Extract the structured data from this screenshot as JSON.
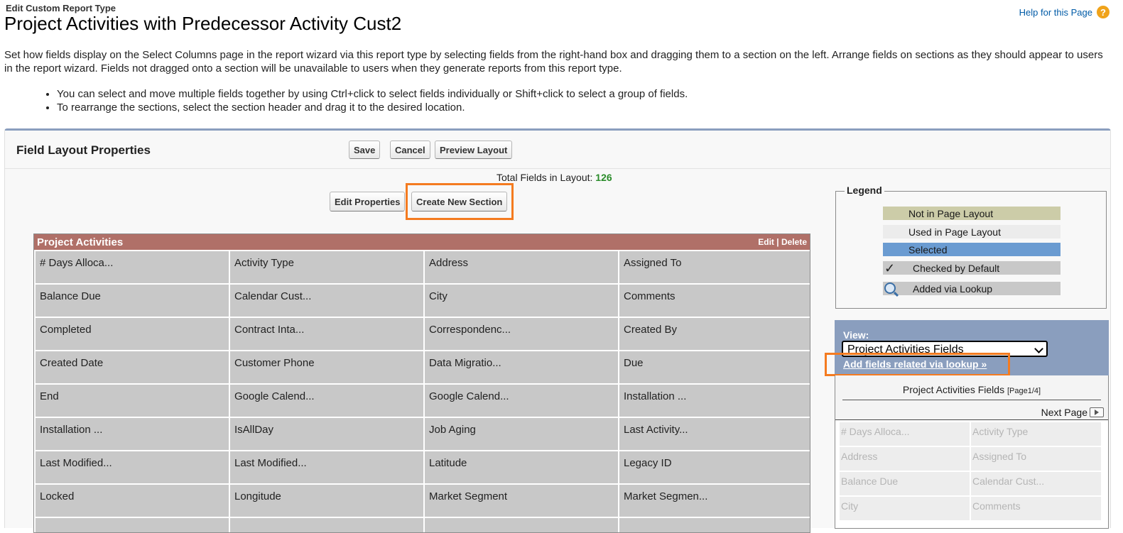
{
  "header": {
    "subtitle": "Edit Custom Report Type",
    "title": "Project Activities with Predecessor Activity Cust2",
    "help_link": "Help for this Page"
  },
  "description": "Set how fields display on the Select Columns page in the report wizard via this report type by selecting fields from the right-hand box and dragging them to a section on the left. Arrange fields on sections as they should appear to users in the report wizard. Fields not dragged onto a section will be unavailable to users when they generate reports from this report type.",
  "tips": [
    "You can select and move multiple fields together by using Ctrl+click to select fields individually or Shift+click to select a group of fields.",
    "To rearrange the sections, select the section header and drag it to the desired location."
  ],
  "layout": {
    "title": "Field Layout Properties",
    "save_label": "Save",
    "cancel_label": "Cancel",
    "preview_label": "Preview Layout",
    "total_label": "Total Fields in Layout:",
    "total_count": "126",
    "edit_properties_label": "Edit Properties",
    "create_section_label": "Create New Section"
  },
  "section": {
    "title": "Project Activities",
    "edit_label": "Edit",
    "separator": " | ",
    "delete_label": "Delete",
    "fields": [
      "# Days Alloca...",
      "Activity Type",
      "Address",
      "Assigned To",
      "Balance Due",
      "Calendar Cust...",
      "City",
      "Comments",
      "Completed",
      "Contract Inta...",
      "Correspondenc...",
      "Created By",
      "Created Date",
      "Customer Phone",
      "Data Migratio...",
      "Due",
      "End",
      "Google Calend...",
      "Google Calend...",
      "Installation ...",
      "Installation ...",
      "IsAllDay",
      "Job Aging",
      "Last Activity...",
      "Last Modified...",
      "Last Modified...",
      "Latitude",
      "Legacy ID",
      "Locked",
      "Longitude",
      "Market Segment",
      "Market Segmen...",
      "",
      "",
      "",
      ""
    ]
  },
  "legend": {
    "title": "Legend",
    "items": [
      {
        "label": "Not in Page Layout",
        "color": "#cccca8"
      },
      {
        "label": "Used in Page Layout",
        "color": "#ececec"
      },
      {
        "label": "Selected",
        "color": "#6a9bd1"
      },
      {
        "label": "Checked by Default",
        "color": "#c8c8c8",
        "icon": "checkmark-icon"
      },
      {
        "label": "Added via Lookup",
        "color": "#c8c8c8",
        "icon": "magnifier-icon"
      }
    ]
  },
  "view": {
    "label": "View:",
    "selected": "Project Activities Fields",
    "lookup_link": "Add fields related via lookup »"
  },
  "fields_panel": {
    "title": "Project Activities Fields",
    "page_indicator": "[Page1/4]",
    "next_page_label": "Next Page",
    "fields": [
      "# Days Alloca...",
      "Activity Type",
      "Address",
      "Assigned To",
      "Balance Due",
      "Calendar Cust...",
      "City",
      "Comments"
    ]
  },
  "colors": {
    "section_header": "#b07068",
    "view_panel": "#8a9ebe",
    "highlight": "#f47b20",
    "total_count": "#2a8c2a"
  }
}
